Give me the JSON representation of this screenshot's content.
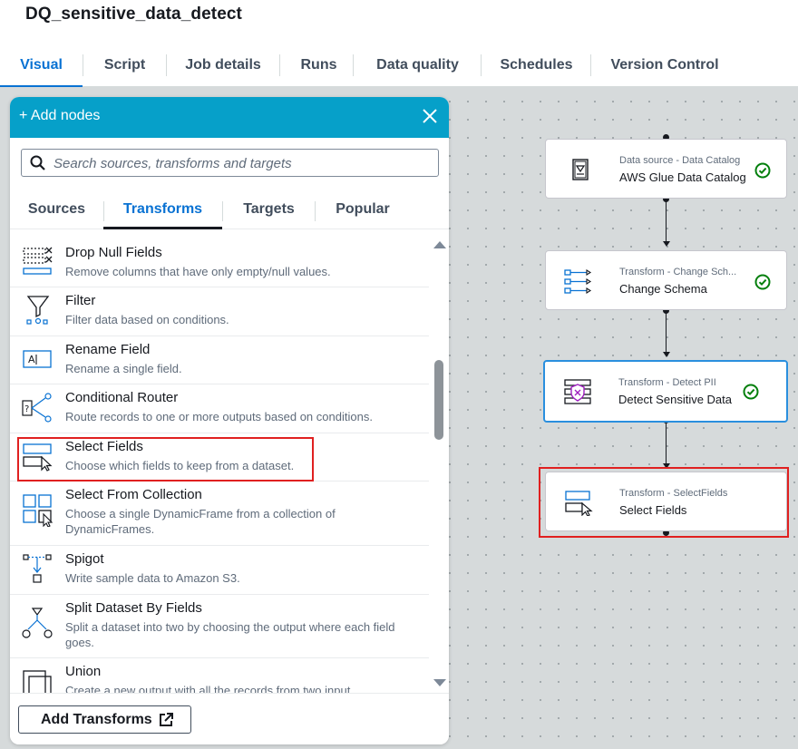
{
  "job": {
    "title": "DQ_sensitive_data_detect"
  },
  "tabs": [
    "Visual",
    "Script",
    "Job details",
    "Runs",
    "Data quality",
    "Schedules",
    "Version Control"
  ],
  "panel": {
    "title": "+ Add nodes",
    "search_placeholder": "Search sources, transforms and targets",
    "tabs": [
      "Sources",
      "Transforms",
      "Targets",
      "Popular"
    ],
    "items": [
      {
        "title": "Drop Null Fields",
        "desc": "Remove columns that have only empty/null values.",
        "icon": "drop-null-fields-icon"
      },
      {
        "title": "Filter",
        "desc": "Filter data based on conditions.",
        "icon": "filter-icon"
      },
      {
        "title": "Rename Field",
        "desc": "Rename a single field.",
        "icon": "rename-field-icon"
      },
      {
        "title": "Conditional Router",
        "desc": "Route records to one or more outputs based on conditions.",
        "icon": "conditional-router-icon"
      },
      {
        "title": "Select Fields",
        "desc": "Choose which fields to keep from a dataset.",
        "icon": "select-fields-icon"
      },
      {
        "title": "Select From Collection",
        "desc": "Choose a single DynamicFrame from a collection of DynamicFrames.",
        "icon": "select-from-collection-icon"
      },
      {
        "title": "Spigot",
        "desc": "Write sample data to Amazon S3.",
        "icon": "spigot-icon"
      },
      {
        "title": "Split Dataset By Fields",
        "desc": "Split a dataset into two by choosing the output where each field goes.",
        "icon": "split-dataset-icon"
      },
      {
        "title": "Union",
        "desc": "Create a new output with all the records from two input",
        "icon": "union-icon"
      }
    ],
    "add_button": "Add Transforms"
  },
  "nodes": [
    {
      "subtitle": "Data source - Data Catalog",
      "name": "AWS Glue Data Catalog",
      "icon": "data-catalog-icon",
      "status": "success"
    },
    {
      "subtitle": "Transform - Change Sch...",
      "name": "Change Schema",
      "icon": "change-schema-icon",
      "status": "success"
    },
    {
      "subtitle": "Transform - Detect PII",
      "name": "Detect Sensitive Data",
      "icon": "detect-pii-icon",
      "status": "success"
    },
    {
      "subtitle": "Transform - SelectFields",
      "name": "Select Fields",
      "icon": "select-fields-icon",
      "status": ""
    }
  ],
  "colors": {
    "accent": "#0972d3",
    "header": "#06a0c9",
    "highlight": "#e02020",
    "success": "#037f0c"
  }
}
